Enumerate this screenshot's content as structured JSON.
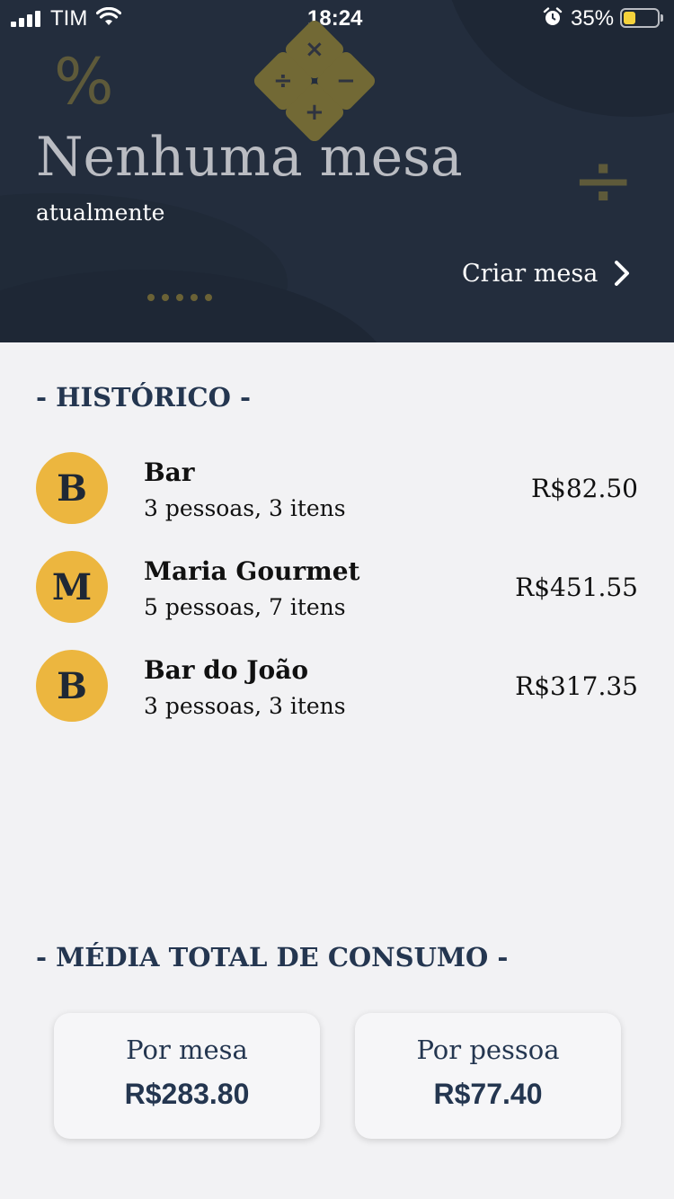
{
  "status_bar": {
    "carrier": "TIM",
    "time": "18:24",
    "battery_percent": "35%",
    "battery_level": 0.35
  },
  "header": {
    "title": "Nenhuma mesa",
    "subtitle": "atualmente",
    "create_label": "Criar mesa",
    "decor": {
      "percent_symbol": "%",
      "divide_symbol": "÷",
      "calc_symbols": [
        "×",
        "÷",
        "−",
        "+"
      ]
    }
  },
  "history": {
    "title": "- HISTÓRICO -",
    "items": [
      {
        "initial": "B",
        "name": "Bar",
        "details": "3 pessoas, 3 itens",
        "total": "R$82.50"
      },
      {
        "initial": "M",
        "name": "Maria Gourmet",
        "details": "5 pessoas, 7 itens",
        "total": "R$451.55"
      },
      {
        "initial": "B",
        "name": "Bar do João",
        "details": "3 pessoas, 3 itens",
        "total": "R$317.35"
      }
    ]
  },
  "average": {
    "title": "- MÉDIA TOTAL DE CONSUMO -",
    "per_table_label": "Por mesa",
    "per_table_value": "R$283.80",
    "per_person_label": "Por pessoa",
    "per_person_value": "R$77.40"
  },
  "colors": {
    "header_bg": "#232d3d",
    "accent": "#ecb63f",
    "heading": "#243650",
    "page_bg": "#f2f2f4"
  }
}
